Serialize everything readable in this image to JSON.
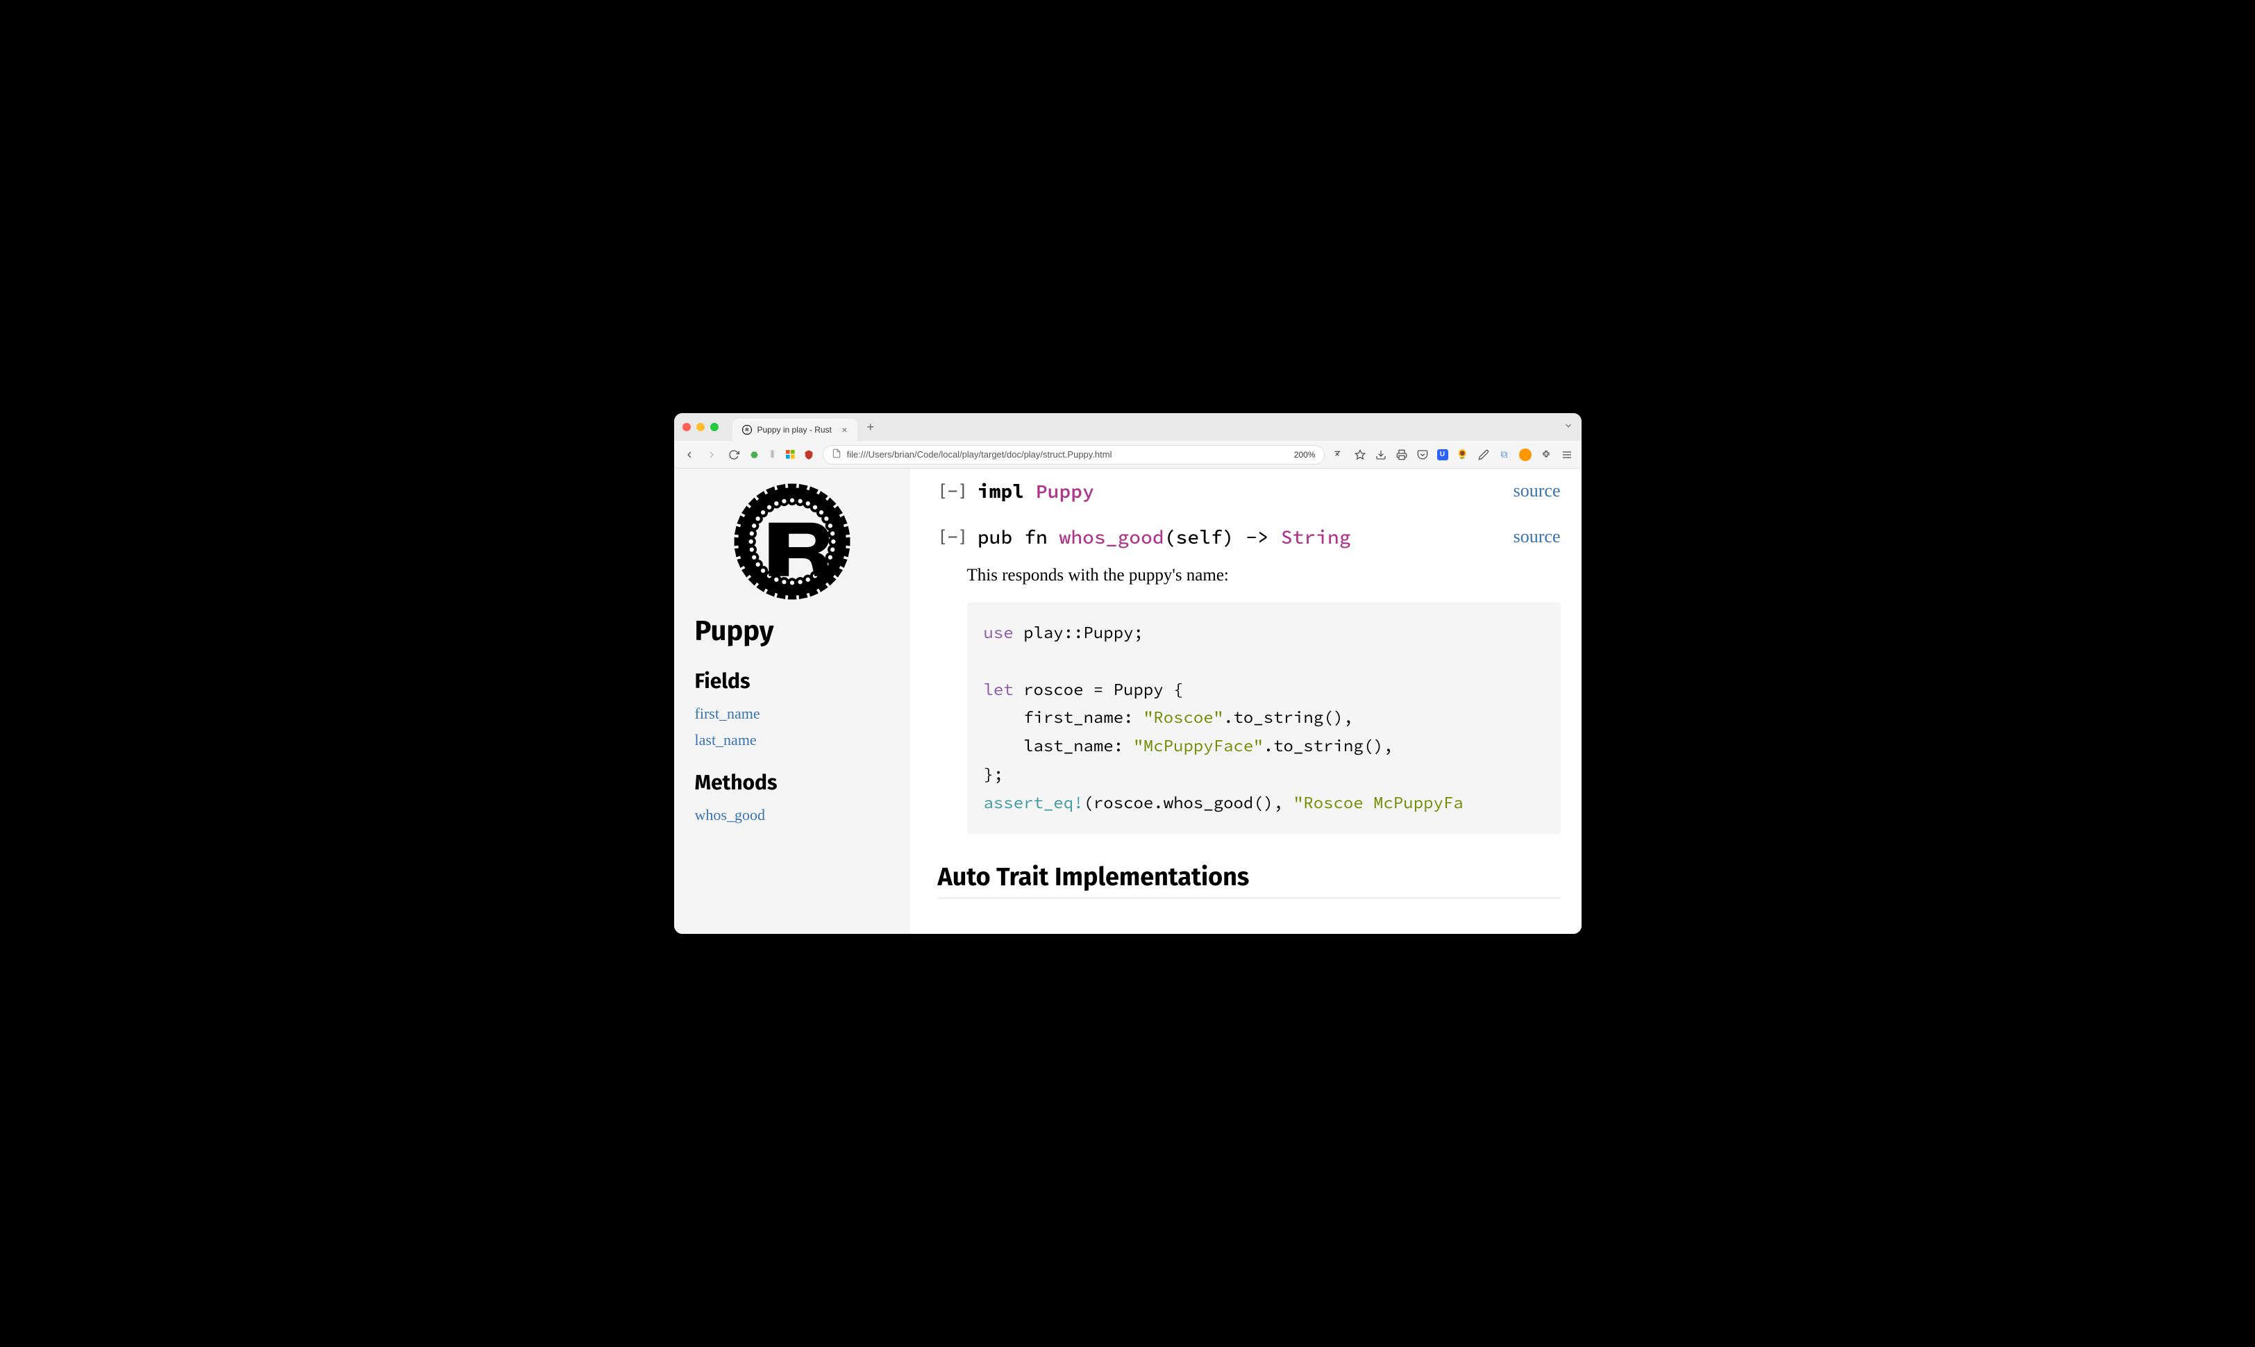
{
  "browser": {
    "tab_title": "Puppy in play - Rust",
    "url": "file:///Users/brian/Code/local/play/target/doc/play/struct.Puppy.html",
    "zoom": "200%"
  },
  "sidebar": {
    "title": "Puppy",
    "sections": {
      "fields": {
        "heading": "Fields",
        "items": [
          "first_name",
          "last_name"
        ]
      },
      "methods": {
        "heading": "Methods",
        "items": [
          "whos_good"
        ]
      }
    }
  },
  "main": {
    "impl": {
      "toggle": "[−]",
      "prefix": "impl ",
      "type": "Puppy",
      "source": "source"
    },
    "fn": {
      "toggle": "[−]",
      "prefix": "pub fn ",
      "name": "whos_good",
      "sig_mid": "(self) -> ",
      "ret": "String",
      "source": "source"
    },
    "doc": "This responds with the puppy's name:",
    "code": {
      "l1_kw": "use",
      "l1_rest": " play::Puppy;",
      "l3_kw": "let",
      "l3_rest": " roscoe = Puppy {",
      "l4_a": "    first_name: ",
      "l4_s": "\"Roscoe\"",
      "l4_b": ".to_string(),",
      "l5_a": "    last_name: ",
      "l5_s": "\"McPuppyFace\"",
      "l5_b": ".to_string(),",
      "l6": "};",
      "l7_macro": "assert_eq!",
      "l7_a": "(roscoe.whos_good(), ",
      "l7_s": "\"Roscoe McPuppyFa"
    },
    "auto_trait_heading": "Auto Trait Implementations"
  }
}
